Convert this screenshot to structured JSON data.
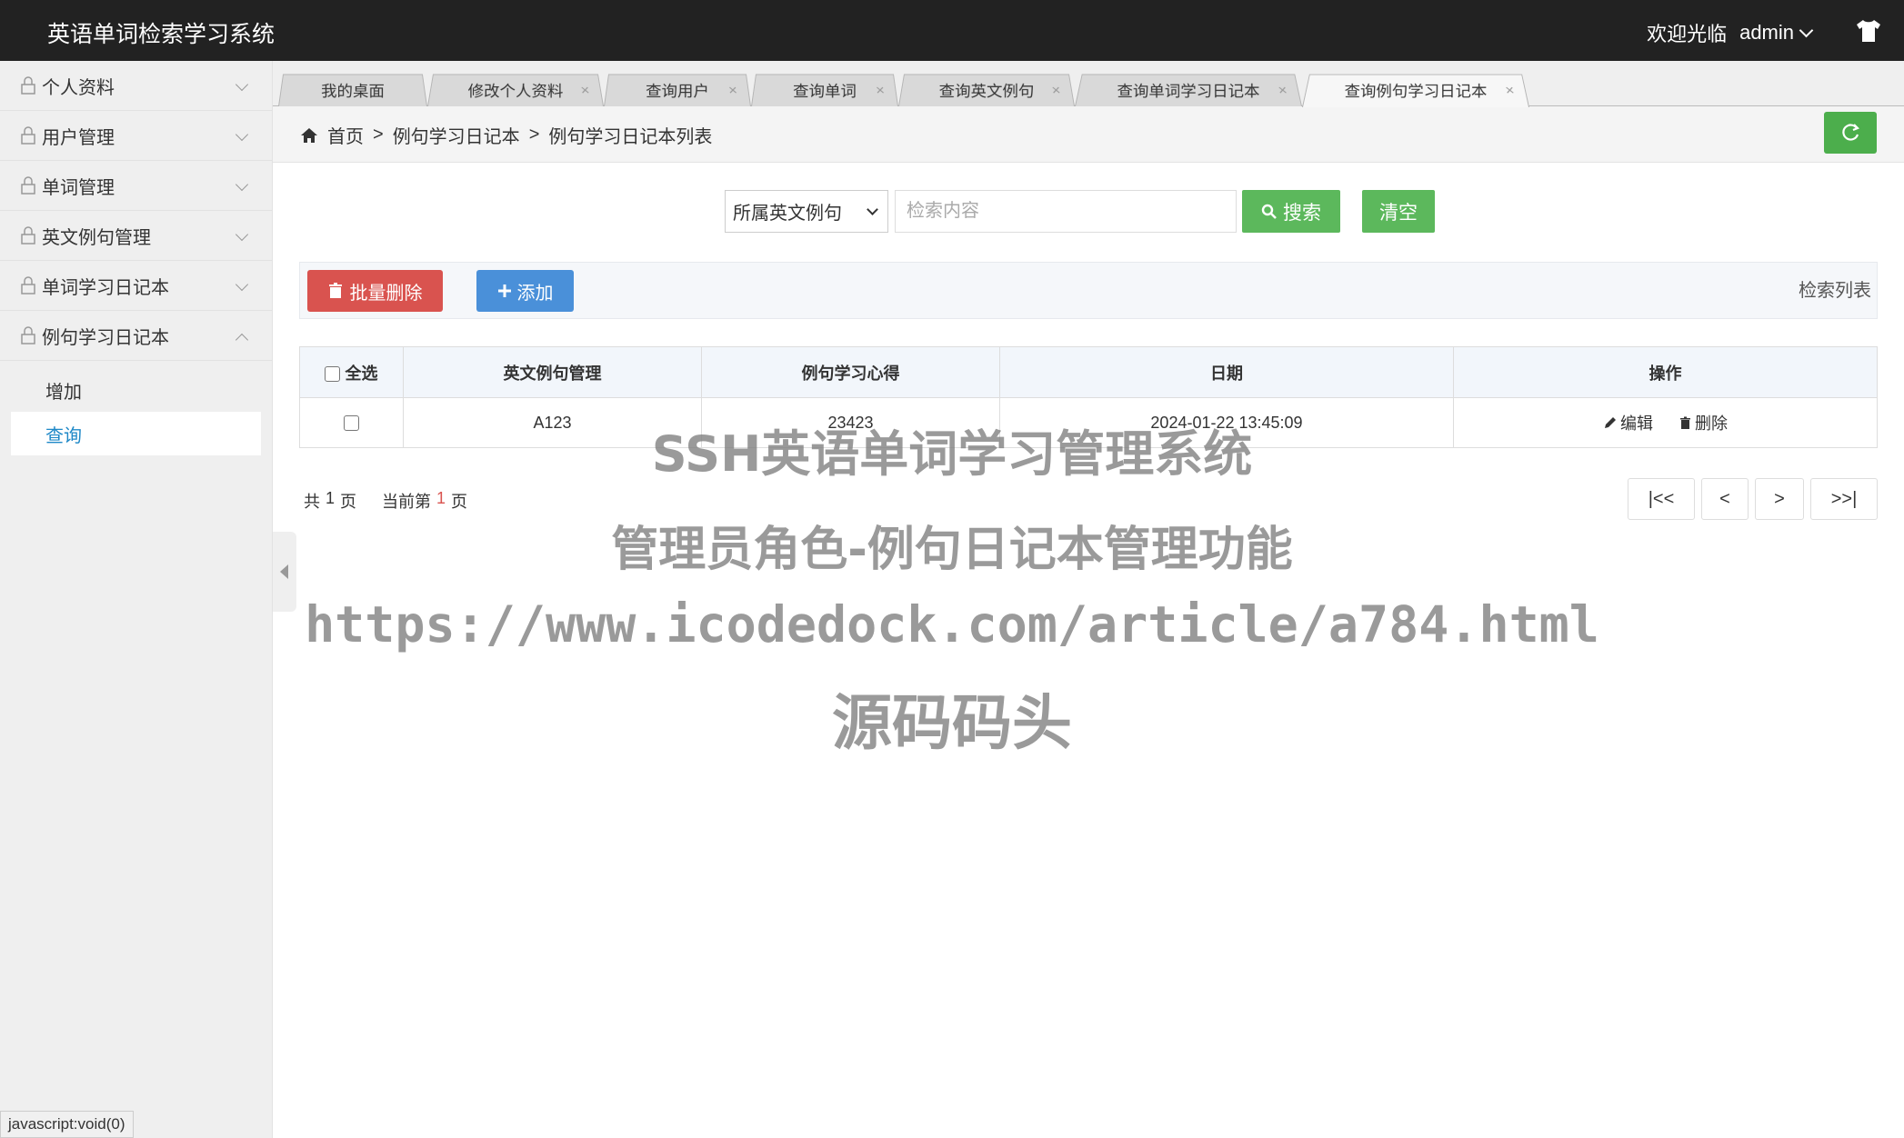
{
  "header": {
    "app_title": "英语单词检索学习系统",
    "welcome": "欢迎光临",
    "username": "admin"
  },
  "sidebar": {
    "items": [
      {
        "label": "个人资料",
        "expanded": false
      },
      {
        "label": "用户管理",
        "expanded": false
      },
      {
        "label": "单词管理",
        "expanded": false
      },
      {
        "label": "英文例句管理",
        "expanded": false
      },
      {
        "label": "单词学习日记本",
        "expanded": false
      },
      {
        "label": "例句学习日记本",
        "expanded": true
      }
    ],
    "sub_items": [
      {
        "label": "增加",
        "active": false
      },
      {
        "label": "查询",
        "active": true
      }
    ],
    "status_url": "javascript:void(0)"
  },
  "tabs": [
    {
      "label": "我的桌面",
      "closable": false
    },
    {
      "label": "修改个人资料",
      "closable": true
    },
    {
      "label": "查询用户",
      "closable": true
    },
    {
      "label": "查询单词",
      "closable": true
    },
    {
      "label": "查询英文例句",
      "closable": true
    },
    {
      "label": "查询单词学习日记本",
      "closable": true
    },
    {
      "label": "查询例句学习日记本",
      "closable": true,
      "active": true
    }
  ],
  "tab_close_glyph": "×",
  "breadcrumb": {
    "home": "首页",
    "sep": ">",
    "level1": "例句学习日记本",
    "level2": "例句学习日记本列表"
  },
  "search": {
    "select_value": "所属英文例句",
    "placeholder": "检索内容",
    "search_label": "搜索",
    "clear_label": "清空"
  },
  "actions": {
    "batch_delete": "批量删除",
    "add": "添加",
    "list_label": "检索列表"
  },
  "table": {
    "headers": [
      "全选",
      "英文例句管理",
      "例句学习心得",
      "日期",
      "操作"
    ],
    "rows": [
      {
        "sentence": "A123",
        "note": "23423",
        "date": "2024-01-22 13:45:09"
      }
    ],
    "edit_label": "编辑",
    "delete_label": "删除"
  },
  "pagination": {
    "total_prefix": "共",
    "total_pages": "1",
    "page_unit": "页",
    "current_prefix": "当前第",
    "current_page": "1",
    "buttons": [
      "|<<",
      "<",
      ">",
      ">>|"
    ]
  },
  "watermark": {
    "line1": "SSH英语单词学习管理系统",
    "line2": "管理员角色-例句日记本管理功能",
    "line3": "https://www.icodedock.com/article/a784.html",
    "line4": "源码码头"
  },
  "colors": {
    "header_bg": "#222222",
    "green": "#5cb85c",
    "red": "#d9534f",
    "blue": "#4a90d9",
    "active_link": "#1e88c7"
  }
}
